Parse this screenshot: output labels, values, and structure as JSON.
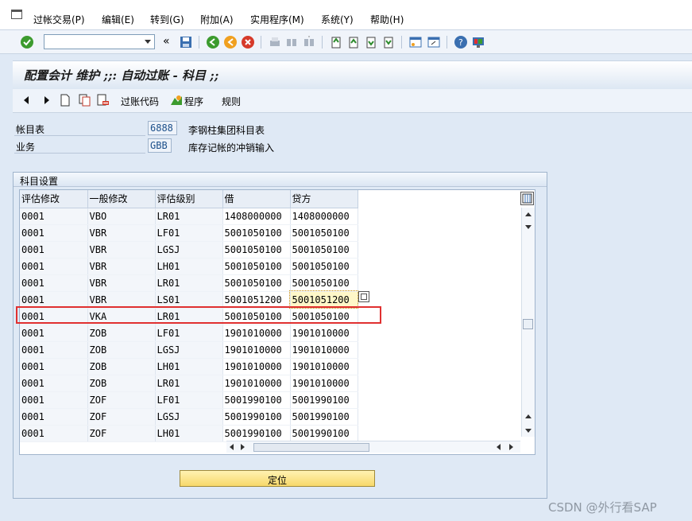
{
  "menu": {
    "items": [
      "过帐交易(P)",
      "编辑(E)",
      "转到(G)",
      "附加(A)",
      "实用程序(M)",
      "系统(Y)",
      "帮助(H)"
    ]
  },
  "toolbar": {
    "command_value": "",
    "back_label": "«"
  },
  "title": "配置会计 维护 ;;: 自动过账 - 科目 ;;",
  "app_toolbar": {
    "posting_code_label": "过账代码",
    "program_label": "程序",
    "rules_label": "规则"
  },
  "header": {
    "chart_label": "帐目表",
    "chart_value": "6888",
    "chart_desc": "李钢柱集团科目表",
    "transaction_label": "业务",
    "transaction_value": "GBB",
    "transaction_desc": "库存记帐的冲销输入"
  },
  "group": {
    "title": "科目设置"
  },
  "table": {
    "columns": [
      "评估修改",
      "一般修改",
      "评估级别",
      "借",
      "贷方"
    ],
    "rows": [
      [
        "0001",
        "VBO",
        "LR01",
        "1408000000",
        "1408000000"
      ],
      [
        "0001",
        "VBR",
        "LF01",
        "5001050100",
        "5001050100"
      ],
      [
        "0001",
        "VBR",
        "LGSJ",
        "5001050100",
        "5001050100"
      ],
      [
        "0001",
        "VBR",
        "LH01",
        "5001050100",
        "5001050100"
      ],
      [
        "0001",
        "VBR",
        "LR01",
        "5001050100",
        "5001050100"
      ],
      [
        "0001",
        "VBR",
        "LS01",
        "5001051200",
        "5001051200"
      ],
      [
        "0001",
        "VKA",
        "LR01",
        "5001050100",
        "5001050100"
      ],
      [
        "0001",
        "ZOB",
        "LF01",
        "1901010000",
        "1901010000"
      ],
      [
        "0001",
        "ZOB",
        "LGSJ",
        "1901010000",
        "1901010000"
      ],
      [
        "0001",
        "ZOB",
        "LH01",
        "1901010000",
        "1901010000"
      ],
      [
        "0001",
        "ZOB",
        "LR01",
        "1901010000",
        "1901010000"
      ],
      [
        "0001",
        "ZOF",
        "LF01",
        "5001990100",
        "5001990100"
      ],
      [
        "0001",
        "ZOF",
        "LGSJ",
        "5001990100",
        "5001990100"
      ],
      [
        "0001",
        "ZOF",
        "LH01",
        "5001990100",
        "5001990100"
      ]
    ]
  },
  "locate_button": "定位",
  "watermark": "CSDN @外行看SAP",
  "colors": {
    "highlight": "#e03030",
    "focus_cell": "#fff7c8",
    "button_yellow": "#f7d86a"
  }
}
